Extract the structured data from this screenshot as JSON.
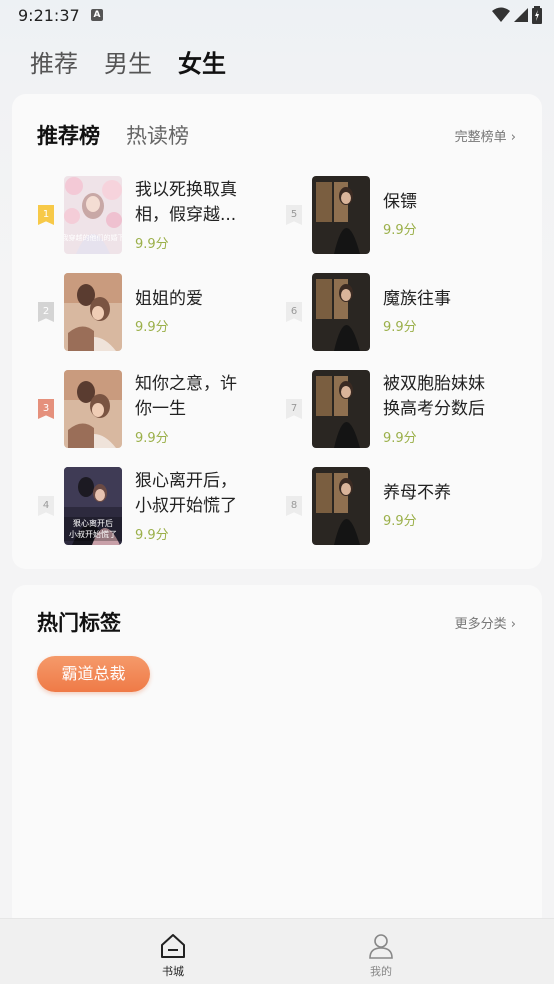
{
  "status_bar": {
    "time": "9:21:37",
    "notification_glyph": "A"
  },
  "top_tabs": [
    {
      "label": "推荐",
      "active": false
    },
    {
      "label": "男生",
      "active": false
    },
    {
      "label": "女生",
      "active": true
    }
  ],
  "ranking": {
    "tabs": [
      {
        "label": "推荐榜",
        "active": true
      },
      {
        "label": "热读榜",
        "active": false
      }
    ],
    "more_label": "完整榜单",
    "books": [
      {
        "rank": "1",
        "title": "我以死换取真相，假穿越...",
        "score": "9.9分",
        "cover": "pastel-flowers"
      },
      {
        "rank": "2",
        "title": "姐姐的爱",
        "score": "9.9分",
        "cover": "couple-warm"
      },
      {
        "rank": "3",
        "title": "知你之意，许你一生",
        "score": "9.9分",
        "cover": "couple-warm"
      },
      {
        "rank": "4",
        "title": "狠心离开后，小叔开始慌了",
        "score": "9.9分",
        "cover": "couple-dark"
      },
      {
        "rank": "5",
        "title": "保镖",
        "score": "9.9分",
        "cover": "woman-window"
      },
      {
        "rank": "6",
        "title": "魔族往事",
        "score": "9.9分",
        "cover": "woman-window"
      },
      {
        "rank": "7",
        "title": "被双胞胎妹妹换高考分数后",
        "score": "9.9分",
        "cover": "woman-window"
      },
      {
        "rank": "8",
        "title": "养母不养",
        "score": "9.9分",
        "cover": "woman-window"
      }
    ],
    "cover_texts": {
      "book1": "我穿越的他们的婚下",
      "book4_line1": "狠心离开后",
      "book4_line2": "小叔开始慌了"
    }
  },
  "hot_tags": {
    "title": "热门标签",
    "more_label": "更多分类",
    "tags": [
      "霸道总裁"
    ]
  },
  "bottom_nav": [
    {
      "label": "书城",
      "icon": "home-icon",
      "active": true
    },
    {
      "label": "我的",
      "icon": "user-icon",
      "active": false
    }
  ],
  "colors": {
    "score_green": "#9bb04a",
    "tag_orange": "#f08450",
    "rank1_gold": "#f7c948",
    "rank3_salmon": "#e5907c"
  }
}
